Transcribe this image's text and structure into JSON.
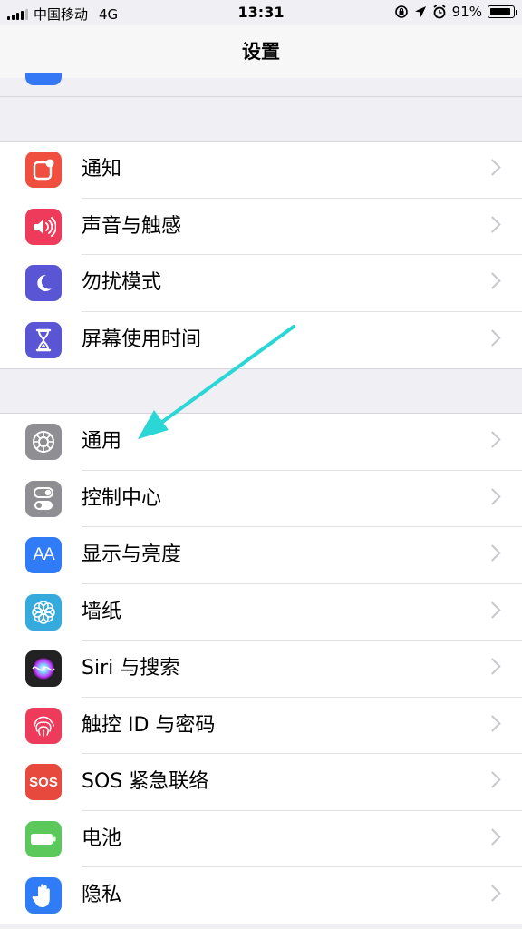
{
  "status_bar": {
    "carrier": "中国移动",
    "network": "4G",
    "time": "13:31",
    "battery": "91%"
  },
  "nav": {
    "title": "设置"
  },
  "groups": [
    {
      "items": [
        {
          "label": "通知",
          "icon": "notification-icon",
          "color": "#f04e3e"
        },
        {
          "label": "声音与触感",
          "icon": "speaker-icon",
          "color": "#ee3b5b"
        },
        {
          "label": "勿扰模式",
          "icon": "moon-icon",
          "color": "#5a55d4"
        },
        {
          "label": "屏幕使用时间",
          "icon": "hourglass-icon",
          "color": "#5a55d4"
        }
      ]
    },
    {
      "items": [
        {
          "label": "通用",
          "icon": "gear-icon",
          "color": "#8e8e93"
        },
        {
          "label": "控制中心",
          "icon": "toggles-icon",
          "color": "#8e8e93"
        },
        {
          "label": "显示与亮度",
          "icon": "text-size-icon",
          "color": "#2f7cf6"
        },
        {
          "label": "墙纸",
          "icon": "flower-icon",
          "color": "#35aadc"
        },
        {
          "label": "Siri 与搜索",
          "icon": "siri-icon",
          "color": "#222222"
        },
        {
          "label": "触控 ID 与密码",
          "icon": "fingerprint-icon",
          "color": "#ee3b5b"
        },
        {
          "label": "SOS 紧急联络",
          "icon": "sos-icon",
          "color": "#e8493d"
        },
        {
          "label": "电池",
          "icon": "battery-icon",
          "color": "#5ac85a"
        },
        {
          "label": "隐私",
          "icon": "hand-icon",
          "color": "#2f7cf6"
        }
      ]
    }
  ],
  "sos_text": "SOS",
  "text_size_glyph": "AA"
}
